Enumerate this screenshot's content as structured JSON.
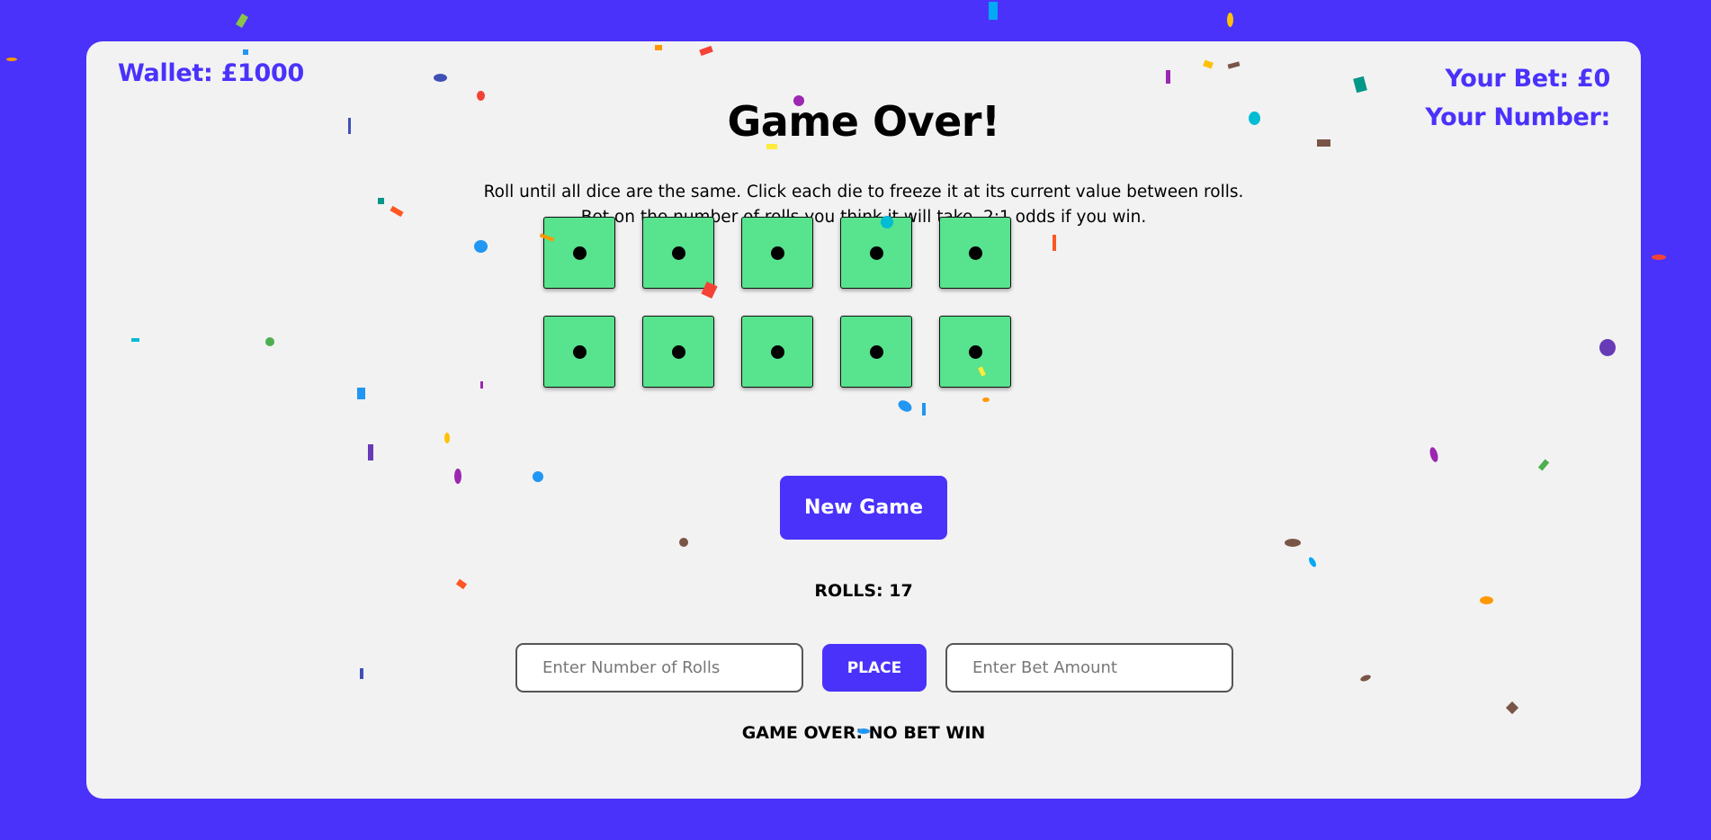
{
  "header": {
    "wallet_text": "Wallet: £1000",
    "bet_text": "Your Bet: £0",
    "number_text": "Your Number:"
  },
  "game": {
    "title": "Game Over!",
    "instruction_line1": "Roll until all dice are the same. Click each die to freeze it at its current value between rolls.",
    "instruction_line2": "Bet on the number of rolls you think it will take. 2:1 odds if you win.",
    "dice_values": [
      1,
      1,
      1,
      1,
      1,
      1,
      1,
      1,
      1,
      1
    ],
    "new_game_label": "New Game",
    "rolls_text": "ROLLS: 17",
    "status_text": "GAME OVER: NO BET WIN"
  },
  "betting": {
    "rolls_placeholder": "Enter Number of Rolls",
    "rolls_value": "",
    "place_label": "PLACE",
    "amount_placeholder": "Enter Bet Amount",
    "amount_value": ""
  },
  "colors": {
    "background": "#4a32fb",
    "card": "#f2f2f2",
    "accent": "#4a32fb",
    "die": "#58e38e"
  }
}
